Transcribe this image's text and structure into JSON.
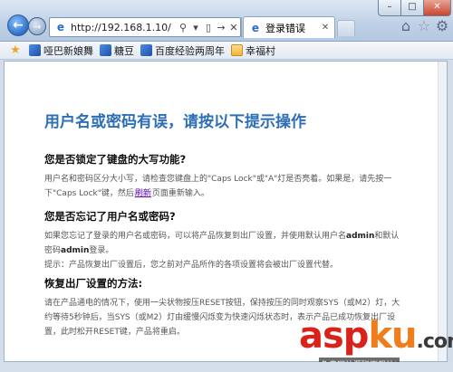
{
  "browser": {
    "address_url": "http://192.168.1.10/",
    "tab_title": "登录错误"
  },
  "favorites": [
    {
      "label": "哑巴新娘舞",
      "icon": "site-favicon"
    },
    {
      "label": "糖豆",
      "icon": "site-favicon"
    },
    {
      "label": "百度经验两周年",
      "icon": "site-favicon"
    },
    {
      "label": "幸福村",
      "icon": "folder-icon"
    }
  ],
  "page": {
    "title": "用户名或密码有误，请按以下提示操作",
    "sections": [
      {
        "heading": "您是否锁定了键盘的大写功能?",
        "text_before": "用户名和密码区分大小写，请检查您键盘上的\"Caps Lock\"或\"A\"灯是否亮着。如果是，请先按一下\"Caps Lock\"键，然后",
        "link": "刷新",
        "text_after": "页面重新输入。"
      },
      {
        "heading": "您是否忘记了用户名或密码?",
        "line1_a": "如果您忘记了登录的用户名或密码，可以将产品恢复到出厂设置，并使用默认用户名",
        "line1_b": "admin",
        "line1_c": "和默认密码",
        "line1_d": "admin",
        "line1_e": "登录。",
        "line2": "提示：产品恢复出厂设置后，您之前对产品所作的各项设置将会被出厂设置代替。"
      },
      {
        "heading": "恢复出厂设置的方法:",
        "text": "请在产品通电的情况下，使用一尖状物按压RESET按钮，保持按压的同时观察SYS（或M2）灯，大约等待5秒钟后，当SYS（或M2）灯由缓慢闪烁变为快速闪烁状态时，表示产品已成功恢复出厂设置，此时松开RESET键，产品将重启。"
      }
    ]
  },
  "watermark": {
    "main_a": "asp",
    "main_b": "ku",
    "main_c": ".com",
    "sub": "免费网站源码下载站!"
  },
  "colors": {
    "title_blue": "#2d6eb5",
    "link_purple": "#5a1c9a",
    "watermark_red": "#d9231a",
    "watermark_orange": "#f07d1a"
  }
}
